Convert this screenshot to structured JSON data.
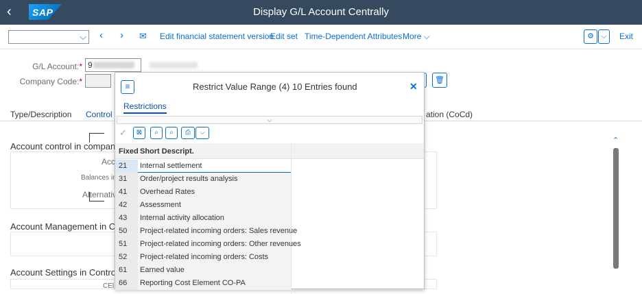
{
  "shell": {
    "back": "‹",
    "logo": "SAP",
    "title": "Display G/L Account Centrally"
  },
  "toolbar": {
    "select_value": "",
    "actions": [
      "Edit financial statement version",
      "Edit set",
      "Time-Dependent Attributes",
      "More"
    ],
    "exit": "Exit"
  },
  "form": {
    "gl_account_label": "G/L Account:",
    "gl_account_value": "9",
    "company_code_label": "Company Code:",
    "required_marker": "*"
  },
  "tabs": [
    "Type/Description",
    "Control D",
    "ation (CoCd)"
  ],
  "sections": {
    "account_control": "Account control in company c",
    "account_management": "Account Management in Com",
    "account_settings": "Account Settings in Controllin",
    "labels": {
      "acc": "Acc",
      "balances": "Balances in L",
      "alternative": "Alternative",
      "cel": "CEl"
    }
  },
  "popup": {
    "title": "Restrict Value Range (4)   10 Entries found",
    "restrictions_tab": "Restrictions",
    "columns": [
      "Fixed",
      "Short Descript."
    ],
    "rows": [
      {
        "fixed": "21",
        "desc": "Internal settlement"
      },
      {
        "fixed": "31",
        "desc": "Order/project results analysis"
      },
      {
        "fixed": "41",
        "desc": "Overhead Rates"
      },
      {
        "fixed": "42",
        "desc": "Assessment"
      },
      {
        "fixed": "43",
        "desc": "Internal activity allocation"
      },
      {
        "fixed": "50",
        "desc": "Project-related incoming orders: Sales revenue"
      },
      {
        "fixed": "51",
        "desc": "Project-related incoming orders: Other revenues"
      },
      {
        "fixed": "52",
        "desc": "Project-related incoming orders: Costs"
      },
      {
        "fixed": "61",
        "desc": "Earned value"
      },
      {
        "fixed": "66",
        "desc": "Reporting Cost Element CO-PA"
      }
    ]
  },
  "colors": {
    "shell": "#354a5f",
    "link": "#0a6ed1",
    "required": "#bb0000"
  }
}
